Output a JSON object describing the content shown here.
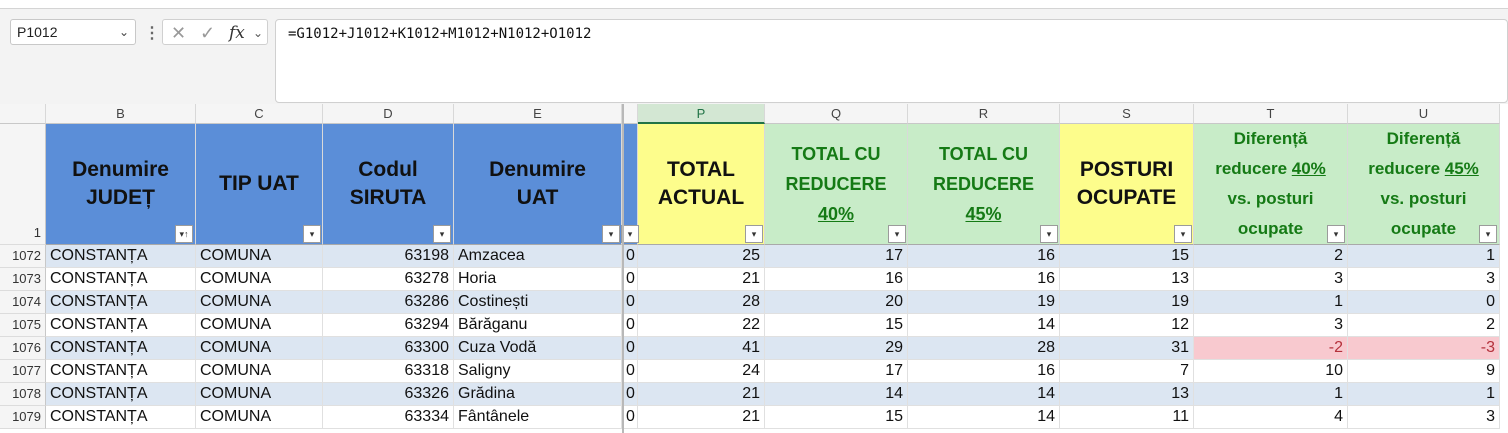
{
  "formula_bar": {
    "name_box": "P1012",
    "formula": "=G1012+J1012+K1012+M1012+N1012+O1012",
    "fx_label": "fx"
  },
  "columns": [
    {
      "letter": "B"
    },
    {
      "letter": "C"
    },
    {
      "letter": "D"
    },
    {
      "letter": "E"
    },
    {
      "letter": ""
    },
    {
      "letter": "P"
    },
    {
      "letter": "Q"
    },
    {
      "letter": "R"
    },
    {
      "letter": "S"
    },
    {
      "letter": "T"
    },
    {
      "letter": "U"
    }
  ],
  "header_row_number": "1",
  "headers": {
    "b": "Denumire\nJUDEȚ",
    "c": "TIP UAT",
    "d": "Codul\nSIRUTA",
    "e": "Denumire\nUAT",
    "p": "TOTAL\nACTUAL",
    "q_line1": "TOTAL CU",
    "q_line2": "REDUCERE",
    "q_pct": "40%",
    "r_line1": "TOTAL CU",
    "r_line2": "REDUCERE",
    "r_pct": "45%",
    "s": "POSTURI\nOCUPATE",
    "t_line1": "Diferență",
    "t_pre": "reducere ",
    "t_pct": "40% ",
    "t_line3": "vs. posturi",
    "t_line4": "ocupate",
    "u_line1": "Diferență",
    "u_pre": "reducere ",
    "u_pct": "45% ",
    "u_line3": "vs. posturi",
    "u_line4": "ocupate"
  },
  "rows": [
    {
      "num": "1072",
      "judet": "CONSTANȚA",
      "tip": "COMUNA",
      "siruta": "63198",
      "uat": "Amzacea",
      "o": "0",
      "total": "25",
      "red40": "17",
      "red45": "16",
      "posturi": "15",
      "dif40": "2",
      "dif45": "1"
    },
    {
      "num": "1073",
      "judet": "CONSTANȚA",
      "tip": "COMUNA",
      "siruta": "63278",
      "uat": "Horia",
      "o": "0",
      "total": "21",
      "red40": "16",
      "red45": "16",
      "posturi": "13",
      "dif40": "3",
      "dif45": "3"
    },
    {
      "num": "1074",
      "judet": "CONSTANȚA",
      "tip": "COMUNA",
      "siruta": "63286",
      "uat": "Costinești",
      "o": "0",
      "total": "28",
      "red40": "20",
      "red45": "19",
      "posturi": "19",
      "dif40": "1",
      "dif45": "0"
    },
    {
      "num": "1075",
      "judet": "CONSTANȚA",
      "tip": "COMUNA",
      "siruta": "63294",
      "uat": "Bărăganu",
      "o": "0",
      "total": "22",
      "red40": "15",
      "red45": "14",
      "posturi": "12",
      "dif40": "3",
      "dif45": "2"
    },
    {
      "num": "1076",
      "judet": "CONSTANȚA",
      "tip": "COMUNA",
      "siruta": "63300",
      "uat": "Cuza Vodă",
      "o": "0",
      "total": "41",
      "red40": "29",
      "red45": "28",
      "posturi": "31",
      "dif40": "-2",
      "dif45": "-3"
    },
    {
      "num": "1077",
      "judet": "CONSTANȚA",
      "tip": "COMUNA",
      "siruta": "63318",
      "uat": "Saligny",
      "o": "0",
      "total": "24",
      "red40": "17",
      "red45": "16",
      "posturi": "7",
      "dif40": "10",
      "dif45": "9"
    },
    {
      "num": "1078",
      "judet": "CONSTANȚA",
      "tip": "COMUNA",
      "siruta": "63326",
      "uat": "Grădina",
      "o": "0",
      "total": "21",
      "red40": "14",
      "red45": "14",
      "posturi": "13",
      "dif40": "1",
      "dif45": "1"
    },
    {
      "num": "1079",
      "judet": "CONSTANȚA",
      "tip": "COMUNA",
      "siruta": "63334",
      "uat": "Fântânele",
      "o": "0",
      "total": "21",
      "red40": "15",
      "red45": "14",
      "posturi": "11",
      "dif40": "4",
      "dif45": "3"
    }
  ],
  "colors": {
    "header_blue": "#5b8ed8",
    "header_yellow": "#fdfd8c",
    "header_green": "#c8ecc8",
    "green_text": "#157a15",
    "row_band": "#dce6f2",
    "negative_fill": "#f8c9cf",
    "negative_text": "#b4313b"
  },
  "icons": {
    "filter_dropdown": "dropdown-arrow",
    "filter_sorted": "sort-ascending-filter",
    "cancel": "x-mark",
    "enter": "check-mark",
    "function": "fx",
    "name_box_dropdown": "chevron-down",
    "more": "vertical-dots"
  }
}
